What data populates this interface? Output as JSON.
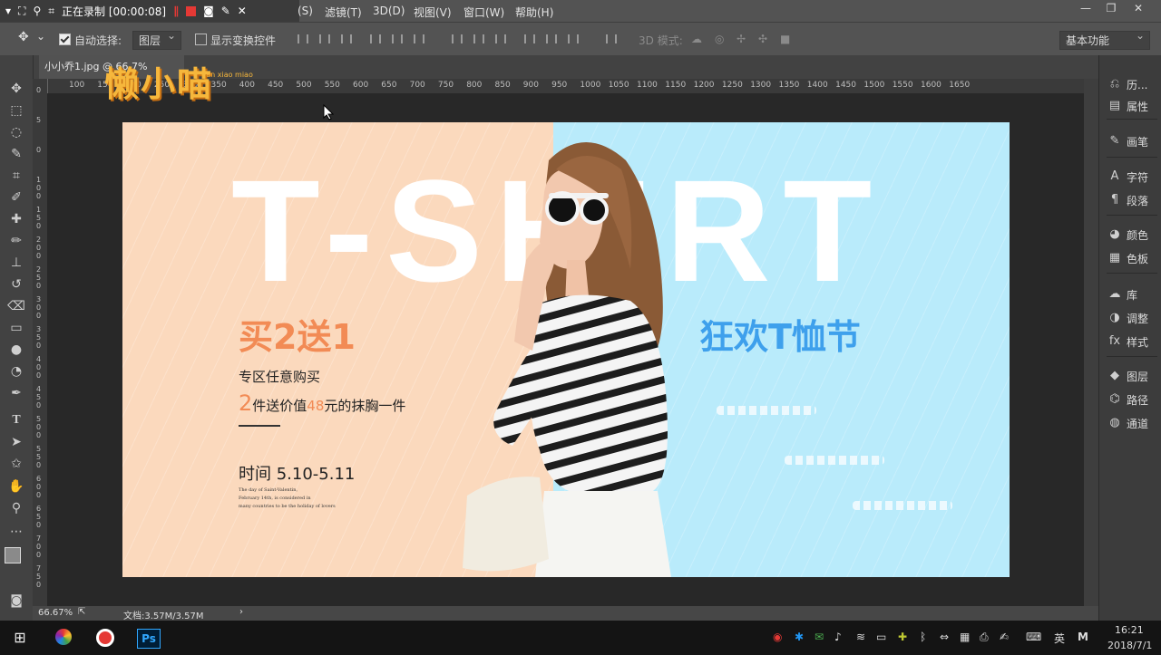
{
  "recorder": {
    "status": "正在录制 [00:00:08]"
  },
  "menu": {
    "items": [
      "(S)",
      "滤镜(T)",
      "3D(D)",
      "视图(V)",
      "窗口(W)",
      "帮助(H)"
    ]
  },
  "options_bar": {
    "auto_select_label": "自动选择:",
    "auto_select_value": "图层",
    "show_transform_label": "显示变换控件",
    "mode_3d_label": "3D 模式:",
    "workspace_value": "基本功能"
  },
  "document_tab": {
    "title": "小小乔1.jpg @ 66.7% (RGB/8)"
  },
  "rulers": {
    "top": [
      "100",
      "150",
      "200",
      "250",
      "300",
      "350",
      "400",
      "450",
      "500",
      "550",
      "600",
      "650",
      "700",
      "750",
      "800",
      "850",
      "900",
      "950",
      "1000",
      "1050",
      "1100",
      "1150",
      "1200",
      "1250",
      "1300",
      "1350",
      "1400",
      "1450",
      "1500",
      "1550",
      "1600",
      "1650"
    ],
    "left": [
      "0",
      "5",
      "0",
      "1 0 0",
      "1 5 0",
      "2 0 0",
      "2 5 0",
      "3 0 0",
      "3 5 0",
      "4 0 0",
      "4 5 0",
      "5 0 0",
      "5 5 0",
      "6 0 0",
      "6 5 0",
      "7 0 0",
      "7 5 0"
    ]
  },
  "banner": {
    "big_title": "T-SHIRT",
    "left_headline": "买2送1",
    "right_headline": "狂欢T恤节",
    "promo_line_1": "专区任意购买",
    "promo_line_2_big": "2",
    "promo_line_2_a": "件送价值",
    "promo_line_2_price": "48",
    "promo_line_2_b": "元的抹胸一件",
    "date_line": "时间 5.10-5.11",
    "fine_print_1": "The day of Saint-Valentin,",
    "fine_print_2": "February 14th, is considered in",
    "fine_print_3": "many countries to be the holiday of lovers"
  },
  "watermark": {
    "logo_text": "懒小喵",
    "logo_sub": "lan xiao miao"
  },
  "panels": {
    "items": [
      {
        "icon": "history-icon",
        "label": "历..."
      },
      {
        "icon": "properties-icon",
        "label": "属性"
      },
      {
        "icon": "brush-icon",
        "label": "画笔"
      },
      {
        "icon": "character-icon",
        "label": "字符"
      },
      {
        "icon": "paragraph-icon",
        "label": "段落"
      },
      {
        "icon": "color-icon",
        "label": "颜色"
      },
      {
        "icon": "swatches-icon",
        "label": "色板"
      },
      {
        "icon": "library-icon",
        "label": "库"
      },
      {
        "icon": "adjustments-icon",
        "label": "调整"
      },
      {
        "icon": "styles-icon",
        "label": "样式"
      },
      {
        "icon": "layers-icon",
        "label": "图层"
      },
      {
        "icon": "paths-icon",
        "label": "路径"
      },
      {
        "icon": "channels-icon",
        "label": "通道"
      }
    ]
  },
  "status_bar": {
    "zoom": "66.67%",
    "doc_info": "文档:3.57M/3.57M"
  },
  "taskbar": {
    "ime": "英",
    "time": "16:21",
    "date": "2018/7/1"
  },
  "colors": {
    "banner_peach": "#fbd9bd",
    "banner_blue": "#b9ebfb",
    "accent_orange": "#f28b55",
    "accent_blue": "#3ea0ec"
  }
}
